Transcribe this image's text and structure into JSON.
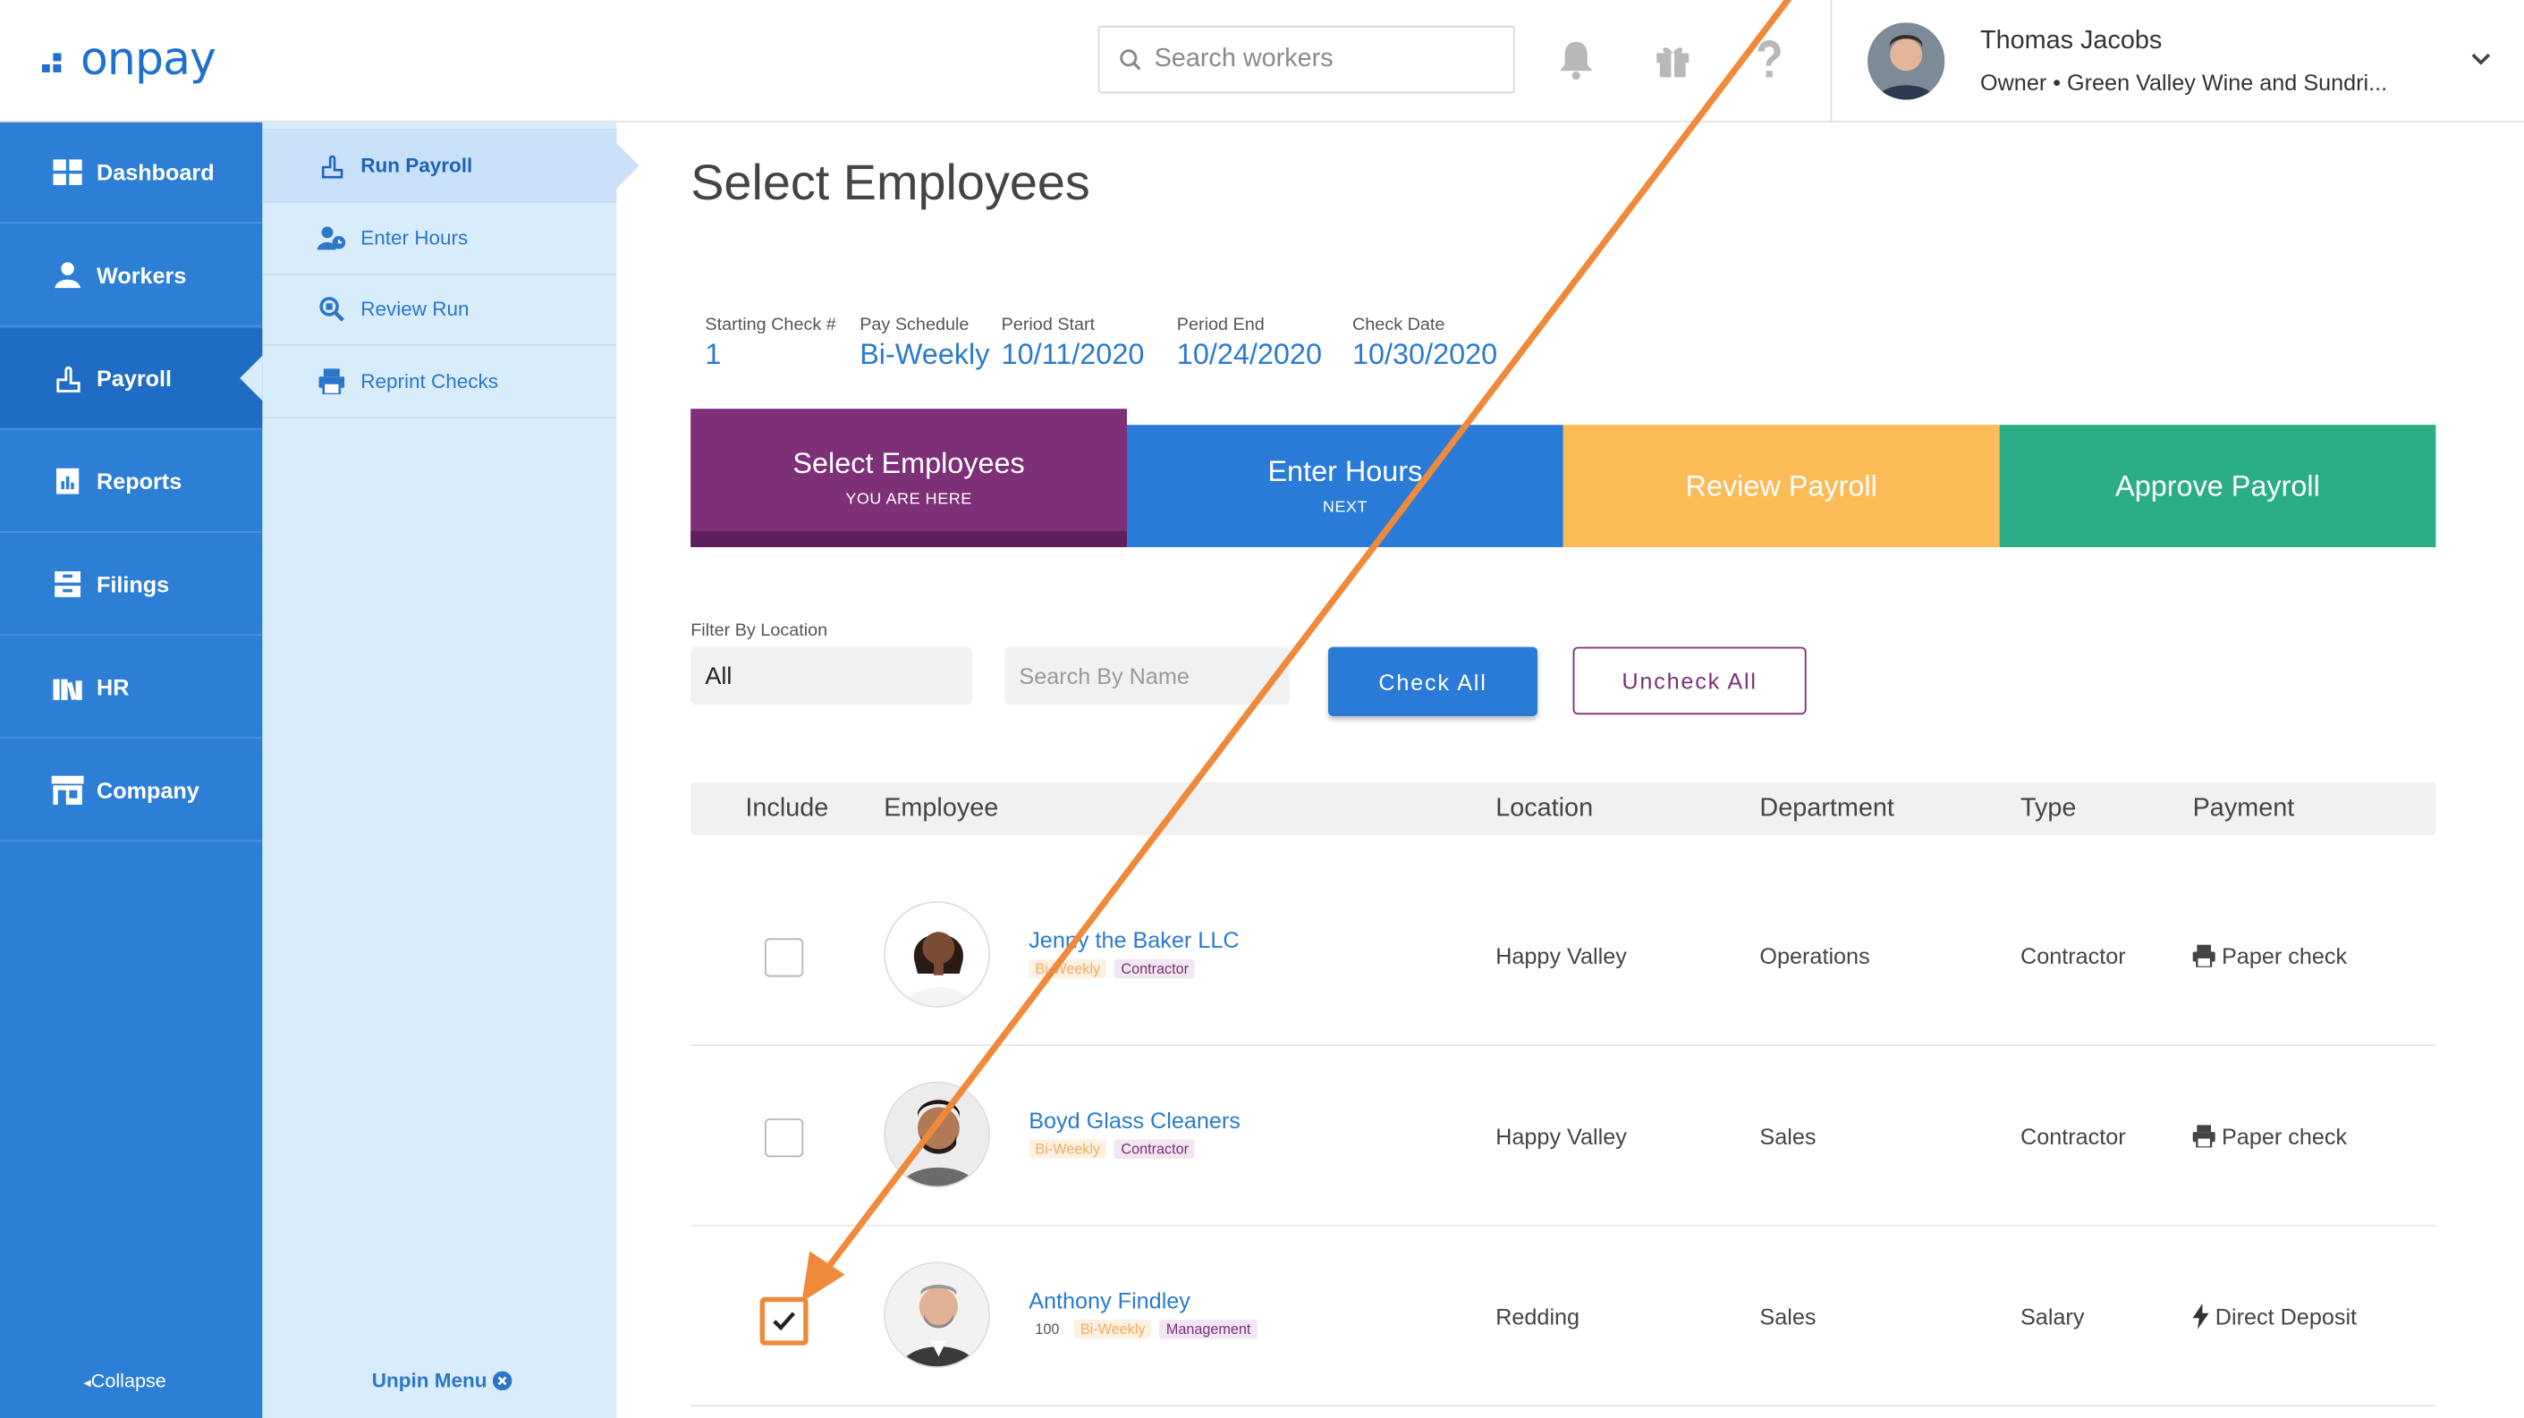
{
  "app": {
    "logo_text": "onpay"
  },
  "header": {
    "search_placeholder": "Search workers",
    "user_name": "Thomas Jacobs",
    "user_role": "Owner • Green Valley Wine and Sundri..."
  },
  "sidebar": {
    "items": [
      {
        "label": "Dashboard",
        "icon": "dashboard-icon"
      },
      {
        "label": "Workers",
        "icon": "workers-icon"
      },
      {
        "label": "Payroll",
        "icon": "payroll-icon"
      },
      {
        "label": "Reports",
        "icon": "reports-icon"
      },
      {
        "label": "Filings",
        "icon": "filings-icon"
      },
      {
        "label": "HR",
        "icon": "hr-icon"
      },
      {
        "label": "Company",
        "icon": "company-icon"
      }
    ],
    "active": "Payroll",
    "collapse_label": "Collapse"
  },
  "submenu": {
    "items": [
      {
        "label": "Run Payroll",
        "icon": "run-payroll-icon"
      },
      {
        "label": "Enter Hours",
        "icon": "enter-hours-icon"
      },
      {
        "label": "Review Run",
        "icon": "review-run-icon"
      },
      {
        "label": "Reprint Checks",
        "icon": "printer-icon"
      }
    ],
    "active": "Run Payroll",
    "unpin_label": "Unpin Menu"
  },
  "main": {
    "title": "Select Employees",
    "meta": [
      {
        "label": "Starting Check #",
        "value": "1"
      },
      {
        "label": "Pay Schedule",
        "value": "Bi-Weekly"
      },
      {
        "label": "Period Start",
        "value": "10/11/2020"
      },
      {
        "label": "Period End",
        "value": "10/24/2020"
      },
      {
        "label": "Check Date",
        "value": "10/30/2020"
      }
    ],
    "steps": [
      {
        "title": "Select Employees",
        "subtitle": "YOU ARE HERE",
        "color": "#7d2f78"
      },
      {
        "title": "Enter Hours",
        "subtitle": "NEXT",
        "color": "#2a7bd7"
      },
      {
        "title": "Review Payroll",
        "subtitle": "",
        "color": "#fdbb57"
      },
      {
        "title": "Approve Payroll",
        "subtitle": "",
        "color": "#2bae87"
      }
    ],
    "filters": {
      "location_label": "Filter By Location",
      "location_value": "All",
      "name_placeholder": "Search By Name",
      "check_all": "Check All",
      "uncheck_all": "Uncheck All"
    },
    "table": {
      "columns": [
        "Include",
        "Employee",
        "Location",
        "Department",
        "Type",
        "Payment"
      ],
      "rows": [
        {
          "name": "Jenny the Baker LLC",
          "number": "",
          "schedule": "Bi-Weekly",
          "role": "Contractor",
          "location": "Happy Valley",
          "department": "Operations",
          "type": "Contractor",
          "payment": "Paper check",
          "payment_icon": "printer-icon",
          "checked": false
        },
        {
          "name": "Boyd Glass Cleaners",
          "number": "",
          "schedule": "Bi-Weekly",
          "role": "Contractor",
          "location": "Happy Valley",
          "department": "Sales",
          "type": "Contractor",
          "payment": "Paper check",
          "payment_icon": "printer-icon",
          "checked": false
        },
        {
          "name": "Anthony Findley",
          "number": "100",
          "schedule": "Bi-Weekly",
          "role": "Management",
          "location": "Redding",
          "department": "Sales",
          "type": "Salary",
          "payment": "Direct Deposit",
          "payment_icon": "bolt-icon",
          "checked": true
        }
      ]
    }
  },
  "colors": {
    "brand_blue": "#2a7bd7",
    "sidebar_blue": "#2d7fd6",
    "purple": "#7d2f78",
    "annotation_orange": "#ef8a3a"
  }
}
